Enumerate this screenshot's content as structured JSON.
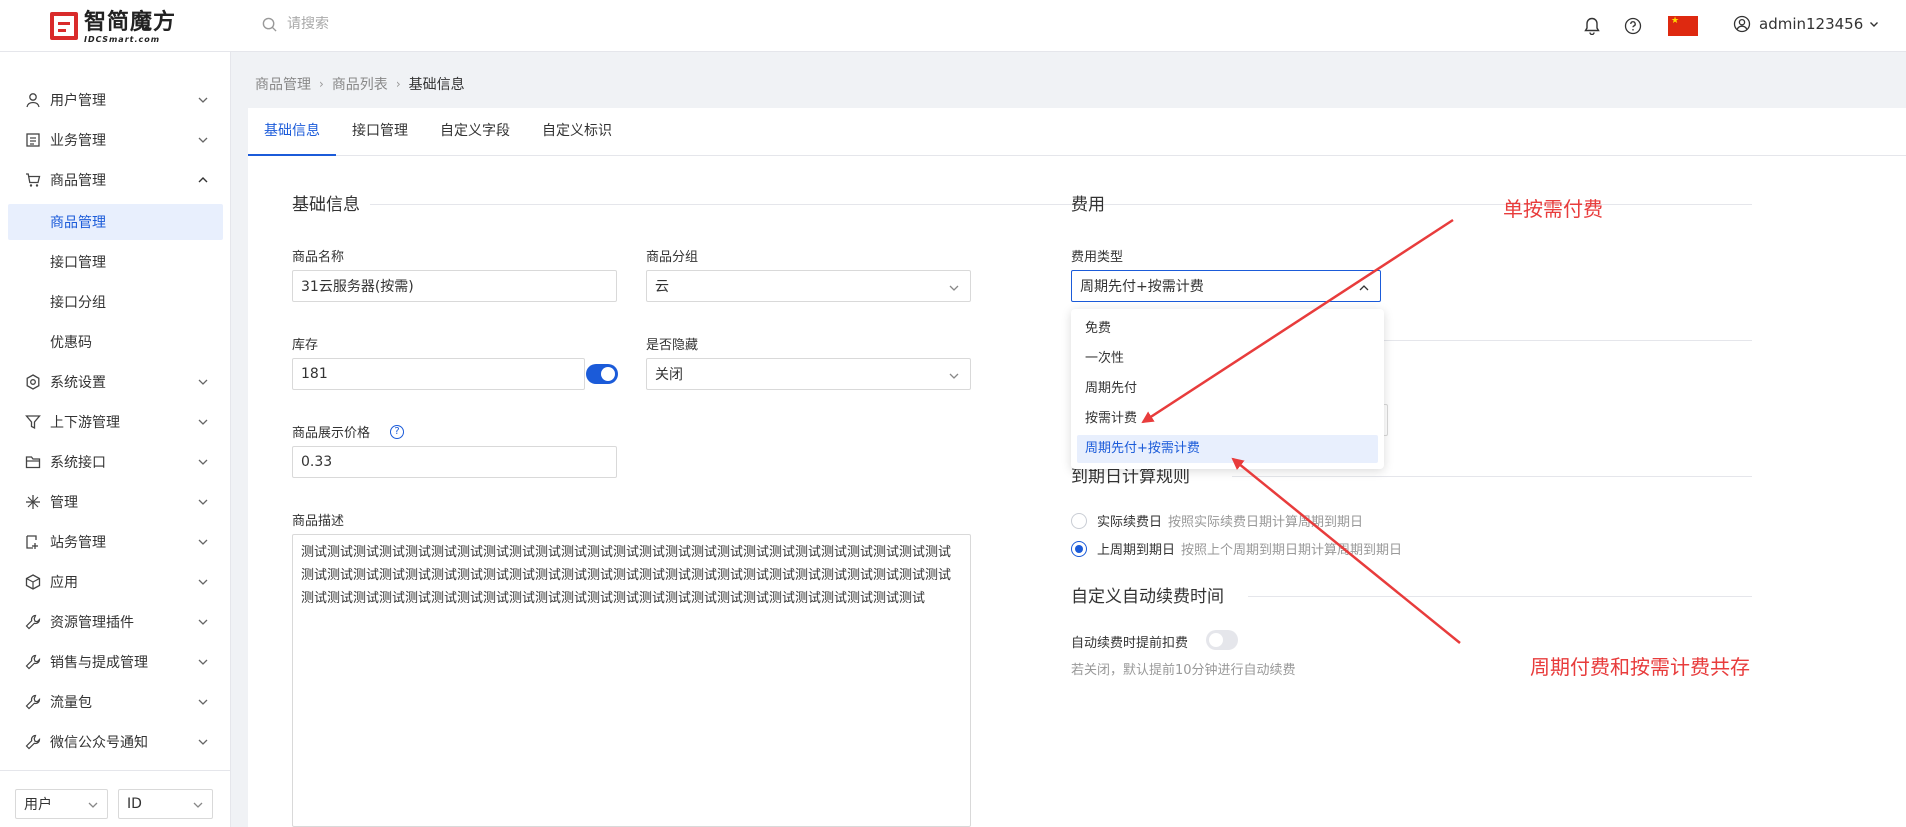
{
  "header": {
    "logo_main": "智简魔方",
    "logo_sub": "IDCSmart.com",
    "search_placeholder": "请搜索",
    "username": "admin123456"
  },
  "sidebar": {
    "items": [
      {
        "label": "用户管理",
        "icon": "user-icon"
      },
      {
        "label": "业务管理",
        "icon": "list-icon"
      },
      {
        "label": "商品管理",
        "icon": "cart-icon",
        "expanded": true
      },
      {
        "label": "系统设置",
        "icon": "gear-icon"
      },
      {
        "label": "上下游管理",
        "icon": "filter-icon"
      },
      {
        "label": "系统接口",
        "icon": "folder-icon"
      },
      {
        "label": "管理",
        "icon": "sparkle-icon"
      },
      {
        "label": "站务管理",
        "icon": "site-icon"
      },
      {
        "label": "应用",
        "icon": "cube-icon"
      },
      {
        "label": "资源管理插件",
        "icon": "wrench-icon"
      },
      {
        "label": "销售与提成管理",
        "icon": "wrench-icon"
      },
      {
        "label": "流量包",
        "icon": "wrench-icon"
      },
      {
        "label": "微信公众号通知",
        "icon": "wrench-icon"
      }
    ],
    "sub_items": [
      "商品管理",
      "接口管理",
      "接口分组",
      "优惠码"
    ],
    "bottom_select_1": "用户",
    "bottom_select_2": "ID"
  },
  "breadcrumb": [
    "商品管理",
    "商品列表",
    "基础信息"
  ],
  "tabs": [
    "基础信息",
    "接口管理",
    "自定义字段",
    "自定义标识"
  ],
  "basic": {
    "title": "基础信息",
    "name_label": "商品名称",
    "name_value": "31云服务器(按需)",
    "group_label": "商品分组",
    "group_value": "云",
    "stock_label": "库存",
    "stock_value": "181",
    "hidden_label": "是否隐藏",
    "hidden_value": "关闭",
    "price_label": "商品展示价格",
    "price_value": "0.33",
    "desc_label": "商品描述",
    "desc_value": "测试测试测试测试测试测试测试测试测试测试测试测试测试测试测试测试测试测试测试测试测试测试测试测试测试测试测试测试测试测试测试测试测试测试测试测试测试测试测试测试测试测试测试测试测试测试测试测试测试测试测试测试测试测试测试测试测试测试测试测试测试测试测试测试测试测试测试测试测试测试测试测试测试测试"
  },
  "fee": {
    "title": "费用",
    "type_label": "费用类型",
    "type_value": "周期先付+按需计费",
    "options": [
      "免费",
      "一次性",
      "周期先付",
      "按需计费",
      "周期先付+按需计费"
    ],
    "expire_title": "到期日计算规则",
    "expire_options": [
      {
        "main": "实际续费日",
        "hint": "按照实际续费日期计算周期到期日",
        "checked": false
      },
      {
        "main": "上周期到期日",
        "hint": "按照上个周期到期日期计算周期到期日",
        "checked": true
      }
    ],
    "auto_title": "自定义自动续费时间",
    "auto_label": "自动续费时提前扣费",
    "auto_hint": "若关闭，默认提前10分钟进行自动续费"
  },
  "annotations": {
    "top": "单按需付费",
    "bottom": "周期付费和按需计费共存"
  },
  "colors": {
    "primary": "#1b5bd9",
    "annotation": "#e83c3c",
    "logo": "#d92b2b"
  }
}
